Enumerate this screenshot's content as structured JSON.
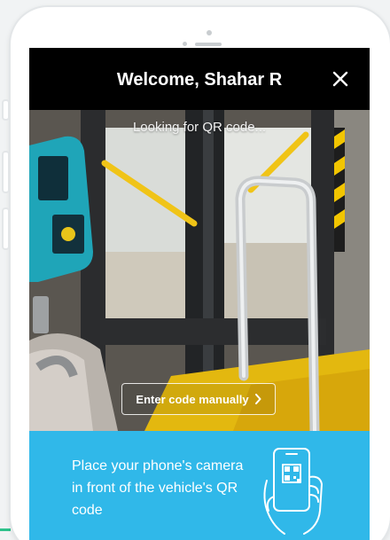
{
  "header": {
    "title": "Welcome, Shahar R",
    "close_icon": "close-icon"
  },
  "scanner": {
    "status": "Looking for QR code...",
    "manual_button_label": "Enter code manually",
    "manual_button_icon": "chevron-right-icon",
    "background": "camera-view-bus-door"
  },
  "instructions": {
    "text": "Place your phone's camera in front of the vehicle's QR code",
    "icon": "hand-holding-phone-qr-icon"
  },
  "colors": {
    "header_bg": "#000000",
    "info_bg": "#30b8e9",
    "accent_green": "#2ec28b"
  }
}
